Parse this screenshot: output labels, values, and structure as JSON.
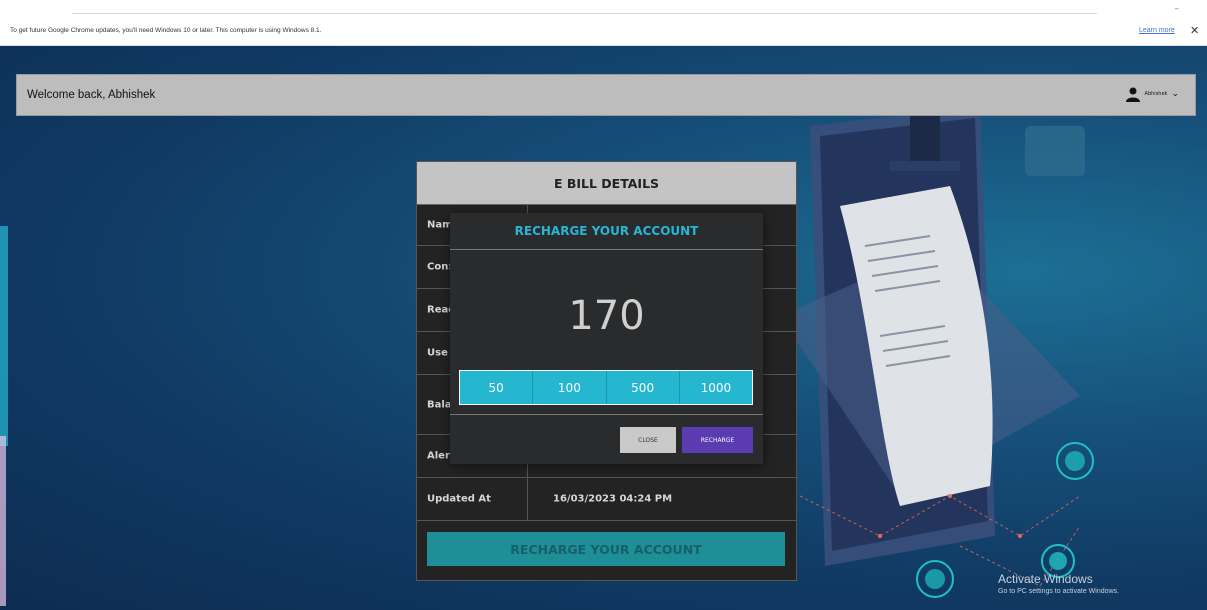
{
  "browser": {
    "infobar_message": "To get future Google Chrome updates, you'll need Windows 10 or later. This computer is using Windows 8.1.",
    "learn_more": "Learn more",
    "close_symbol": "✕",
    "menu_dash": "–"
  },
  "header": {
    "welcome": "Welcome back, Abhishek",
    "user_name": "Abhishek",
    "chevron": "⌄"
  },
  "bill": {
    "title": "E BILL DETAILS",
    "rows": [
      {
        "label": "Nam",
        "value": ""
      },
      {
        "label": "Con:",
        "value": ""
      },
      {
        "label": "Reac",
        "value": ""
      },
      {
        "label": "Use",
        "value": ""
      },
      {
        "label": "Bala",
        "value": ""
      },
      {
        "label": "Aler",
        "value": ""
      },
      {
        "label": "Updated At",
        "value": "16/03/2023 04:24 PM"
      }
    ],
    "button": "RECHARGE YOUR ACCOUNT"
  },
  "modal": {
    "title": "RECHARGE YOUR ACCOUNT",
    "amount": "170",
    "options": [
      "50",
      "100",
      "500",
      "1000"
    ],
    "close": "CLOSE",
    "recharge": "RECHARGE"
  },
  "watermark": {
    "line1": "Activate Windows",
    "line2": "Go to PC settings to activate Windows."
  },
  "colors": {
    "accent_cyan": "#29b6d6",
    "recharge_purple": "#5a3bb0",
    "bill_button_teal": "#1e8e97"
  }
}
